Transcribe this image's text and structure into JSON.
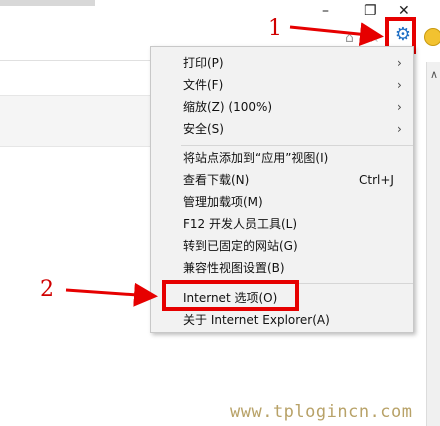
{
  "window": {
    "minimize_glyph": "–",
    "restore_glyph": "❐",
    "close_glyph": "✕"
  },
  "toolbar": {
    "home_icon": "⌂",
    "favorites_icon": "☆",
    "tools_icon": "⚙",
    "feedback_icon": "smiley-icon"
  },
  "menu": {
    "items": [
      {
        "label": "打印(P)",
        "arrow": "›"
      },
      {
        "label": "文件(F)",
        "arrow": "›"
      },
      {
        "label": "缩放(Z) (100%)",
        "arrow": "›"
      },
      {
        "label": "安全(S)",
        "arrow": "›"
      },
      {
        "label": "将站点添加到“应用”视图(I)"
      },
      {
        "label": "查看下载(N)",
        "shortcut": "Ctrl+J"
      },
      {
        "label": "管理加载项(M)"
      },
      {
        "label": "F12 开发人员工具(L)"
      },
      {
        "label": "转到已固定的网站(G)"
      },
      {
        "label": "兼容性视图设置(B)"
      },
      {
        "label": "Internet 选项(O)"
      },
      {
        "label": "关于 Internet Explorer(A)"
      }
    ]
  },
  "annotations": {
    "step1": "1",
    "step2": "2",
    "color": "#e60000"
  },
  "scrollbar": {
    "up_glyph": "∧"
  },
  "watermark": "www.tplogincn.com"
}
